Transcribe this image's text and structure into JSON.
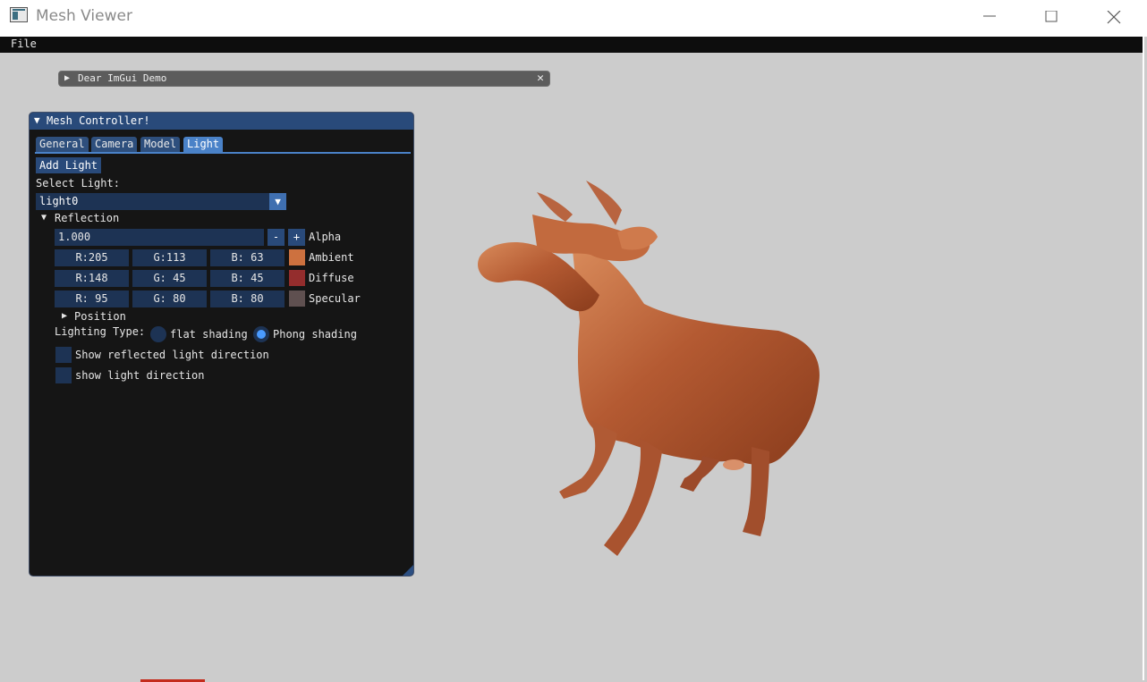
{
  "window": {
    "title": "Mesh Viewer",
    "min": "minimize",
    "max": "maximize",
    "close": "close"
  },
  "menubar": {
    "file": "File"
  },
  "demo": {
    "label": "Dear ImGui Demo",
    "close": "✕"
  },
  "panel": {
    "title": "Mesh Controller!",
    "tabs": [
      "General",
      "Camera",
      "Model",
      "Light"
    ],
    "active_tab": "Light",
    "add_light": "Add Light",
    "select_label": "Select Light:",
    "selected_light": "light0",
    "reflection_label": "Reflection",
    "alpha": {
      "value": "1.000",
      "minus": "-",
      "plus": "+",
      "label": "Alpha"
    },
    "rows": [
      {
        "r": "R:205",
        "g": "G:113",
        "b": "B: 63",
        "label": "Ambient",
        "color": "#cd713f"
      },
      {
        "r": "R:148",
        "g": "G: 45",
        "b": "B: 45",
        "label": "Diffuse",
        "color": "#942d2d"
      },
      {
        "r": "R: 95",
        "g": "G: 80",
        "b": "B: 80",
        "label": "Specular",
        "color": "#5f5050"
      }
    ],
    "position_label": "Position",
    "lighting_type_label": "Lighting Type:",
    "flat_label": "flat shading",
    "phong_label": "Phong shading",
    "selected_shading": "Phong shading",
    "show_reflected": "Show reflected light direction",
    "show_light": "show light direction"
  },
  "viewport": {
    "model": "cow",
    "model_color": "#b45a32"
  }
}
